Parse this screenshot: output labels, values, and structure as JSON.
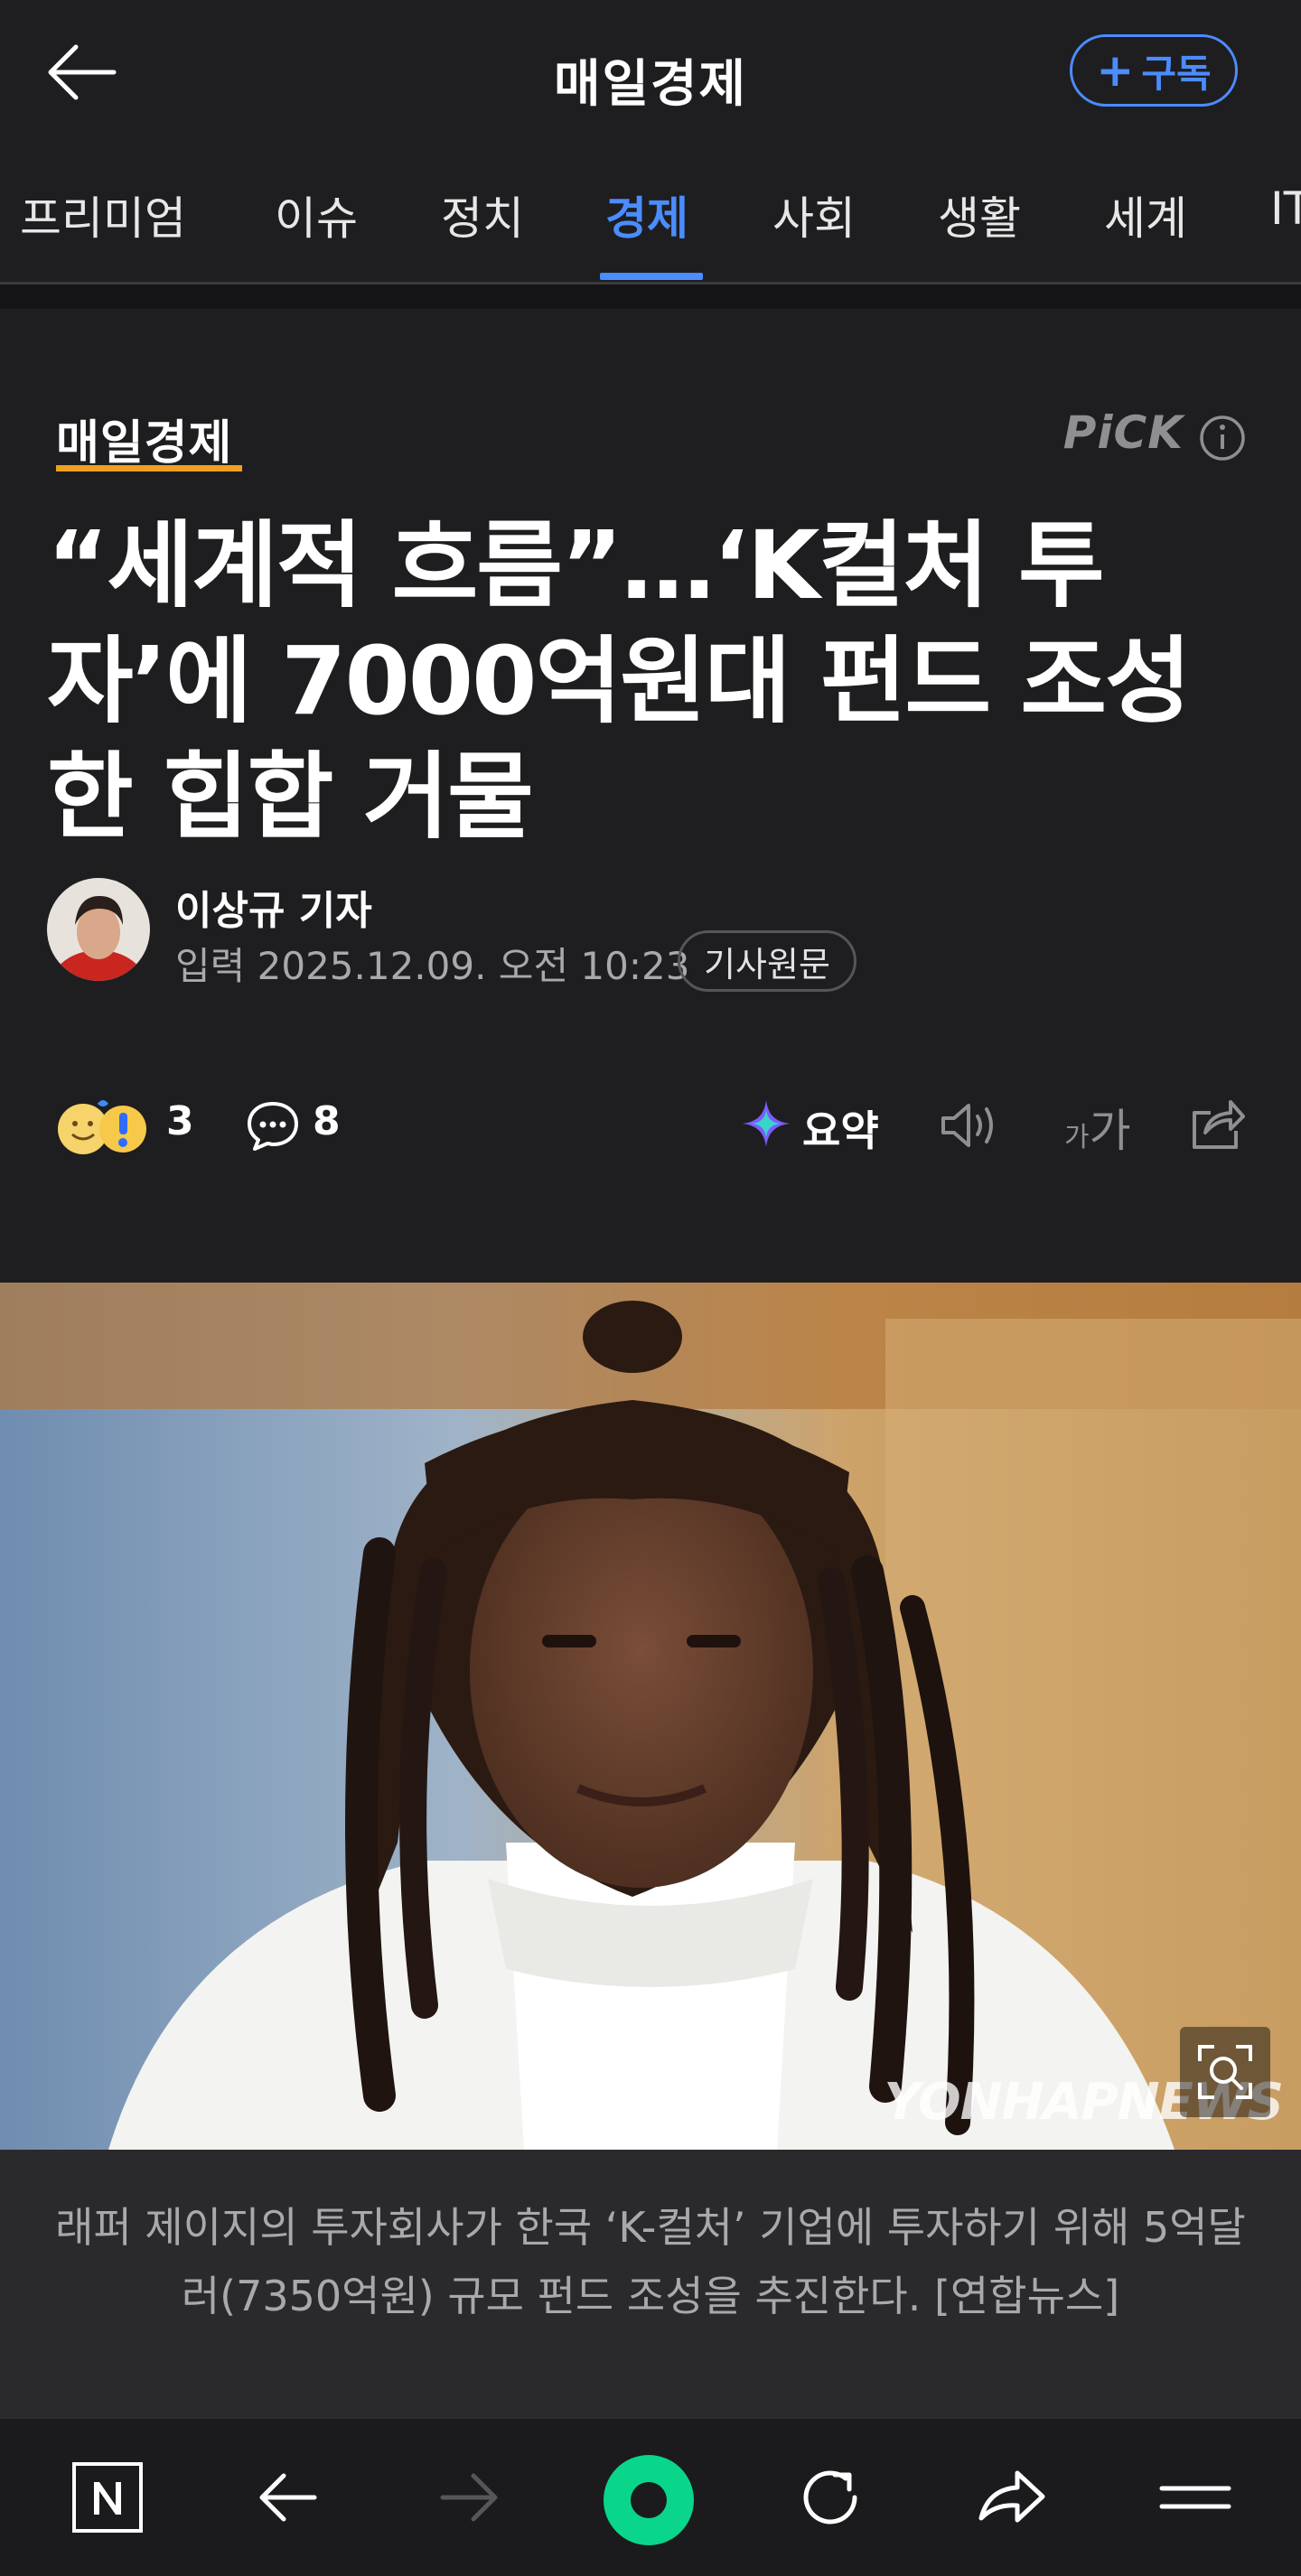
{
  "header": {
    "brand": "매일경제",
    "subscribe_plus": "+",
    "subscribe_label": "구독"
  },
  "tabs": [
    {
      "label": "프리미엄"
    },
    {
      "label": "이슈"
    },
    {
      "label": "정치"
    },
    {
      "label": "경제",
      "active": true
    },
    {
      "label": "사회"
    },
    {
      "label": "생활"
    },
    {
      "label": "세계"
    },
    {
      "label": "IT"
    }
  ],
  "article": {
    "press": "매일경제",
    "pick": "PiCK",
    "headline": "“세계적 흐름”…‘K컬처 투자’에 7000억원대 펀드 조성한 힙합 거물",
    "reporter": "이상규 기자",
    "pubdate": "입력 2025.12.09. 오전 10:23",
    "original_button": "기사원문",
    "reaction_count": "3",
    "comment_count": "8",
    "summary_label": "요약",
    "fontsize_small": "가",
    "fontsize_large": "가",
    "photo_watermark": "YONHAPNEWS",
    "caption": "래퍼 제이지의 투자회사가 한국 ‘K-컬처’ 기업에 투자하기 위해 5억달러(7350억원) 규모 펀드 조성을 추진한다. [연합뉴스]"
  },
  "colors": {
    "accent": "#4b8cff",
    "press_underline": "#f0a020",
    "background": "#1e1e20"
  },
  "icons": {
    "back": "arrow-left-icon",
    "info": "info-circle-icon",
    "reaction": "emoji-reaction-icon",
    "comment": "speech-bubble-icon",
    "summary": "sparkle-icon",
    "speaker": "speaker-icon",
    "share": "share-icon",
    "nav_home": "naver-n-icon",
    "nav_back": "arrow-left-icon",
    "nav_forward": "arrow-right-icon",
    "nav_green": "green-dot-icon",
    "nav_reload": "reload-icon",
    "nav_share": "share-arrow-icon",
    "nav_menu": "menu-icon"
  }
}
